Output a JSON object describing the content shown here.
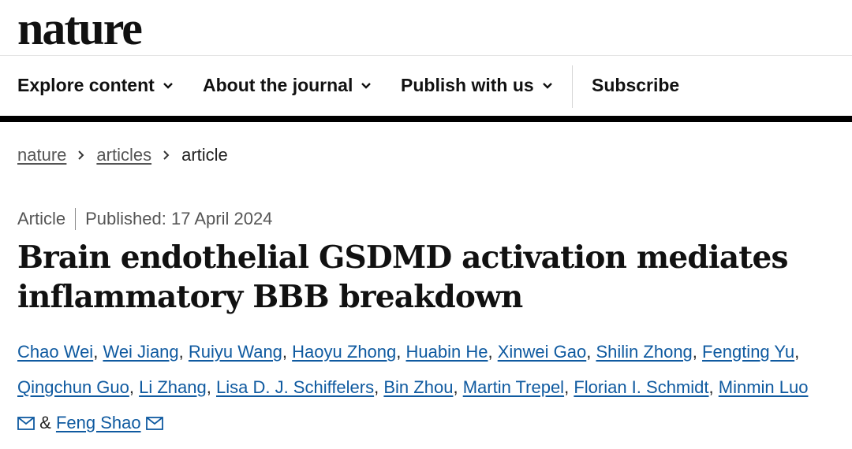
{
  "header": {
    "logo": "nature"
  },
  "nav": {
    "items": [
      {
        "label": "Explore content"
      },
      {
        "label": "About the journal"
      },
      {
        "label": "Publish with us"
      }
    ],
    "subscribe": "Subscribe"
  },
  "breadcrumb": {
    "items": [
      "nature",
      "articles"
    ],
    "current": "article"
  },
  "article": {
    "type": "Article",
    "published": "Published: 17 April 2024",
    "title": "Brain endothelial GSDMD activation mediates inflammatory BBB breakdown"
  },
  "authors": {
    "names": [
      "Chao Wei",
      "Wei Jiang",
      "Ruiyu Wang",
      "Haoyu Zhong",
      "Huabin He",
      "Xinwei Gao",
      "Shilin Zhong",
      "Fengting Yu",
      "Qingchun Guo",
      "Li Zhang",
      "Lisa D. J. Schiffelers",
      "Bin Zhou",
      "Martin Trepel",
      "Florian I. Schmidt",
      "Minmin Luo",
      "Feng Shao"
    ],
    "separator": ",",
    "ampersand": "&",
    "email_icon": "envelope-icon"
  },
  "colors": {
    "link": "#0f5aa0",
    "text": "#222222",
    "muted": "#555555",
    "rule": "#000000"
  }
}
